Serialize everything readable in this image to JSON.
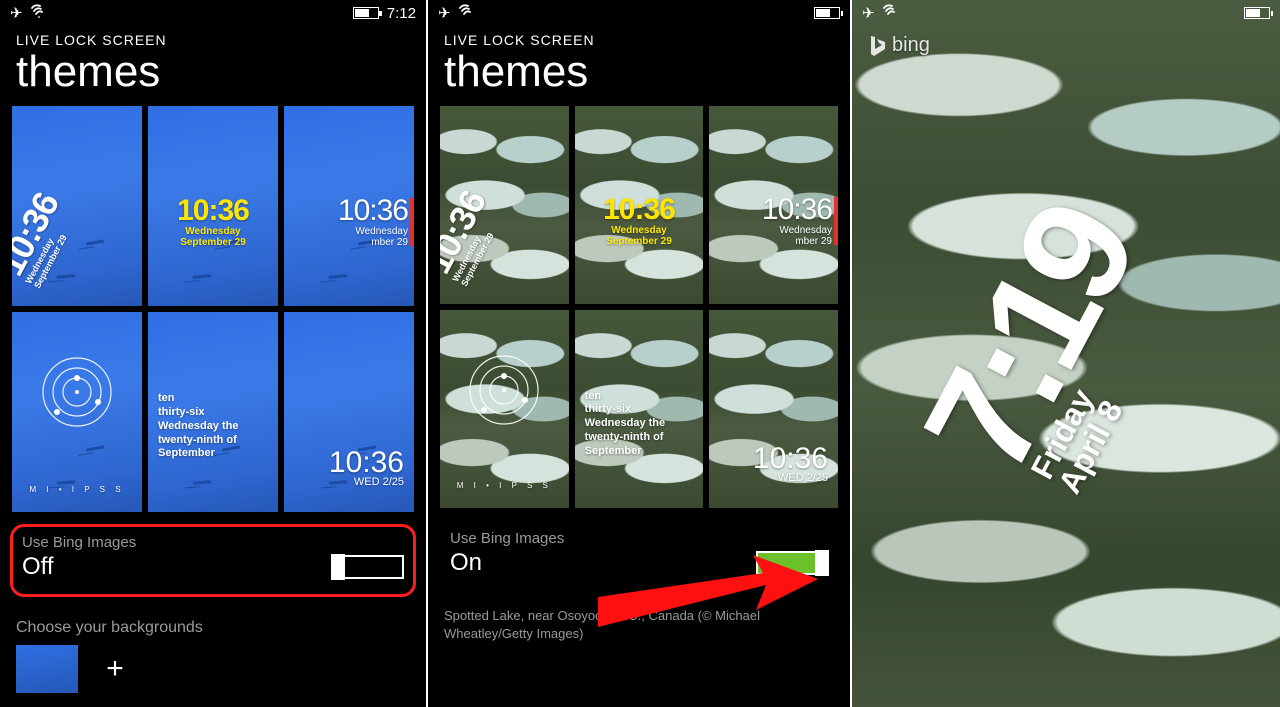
{
  "status": {
    "time": "7:12"
  },
  "app_title": "LIVE LOCK SCREEN",
  "page_title": "themes",
  "themes": {
    "time": "10:36",
    "day_long": "Wednesday",
    "date_long": "September 29",
    "words": "ten\nthirty-six\nWednesday the\ntwenty-ninth of\nSeptember",
    "thin_date": "WED 2/25",
    "c_day": "Wednesday",
    "c_date": "mber 29",
    "strip": "M I • I P S S"
  },
  "toggle": {
    "label": "Use Bing Images",
    "off": "Off",
    "on": "On"
  },
  "choose_label": "Choose your backgrounds",
  "image_caption": "Spotted Lake, near Osoyoos, B.C., Canada (© Michael Wheatley/Getty Images)",
  "lock": {
    "bing": "bing",
    "time": "7:19",
    "day": "Friday",
    "date": "April 8"
  }
}
